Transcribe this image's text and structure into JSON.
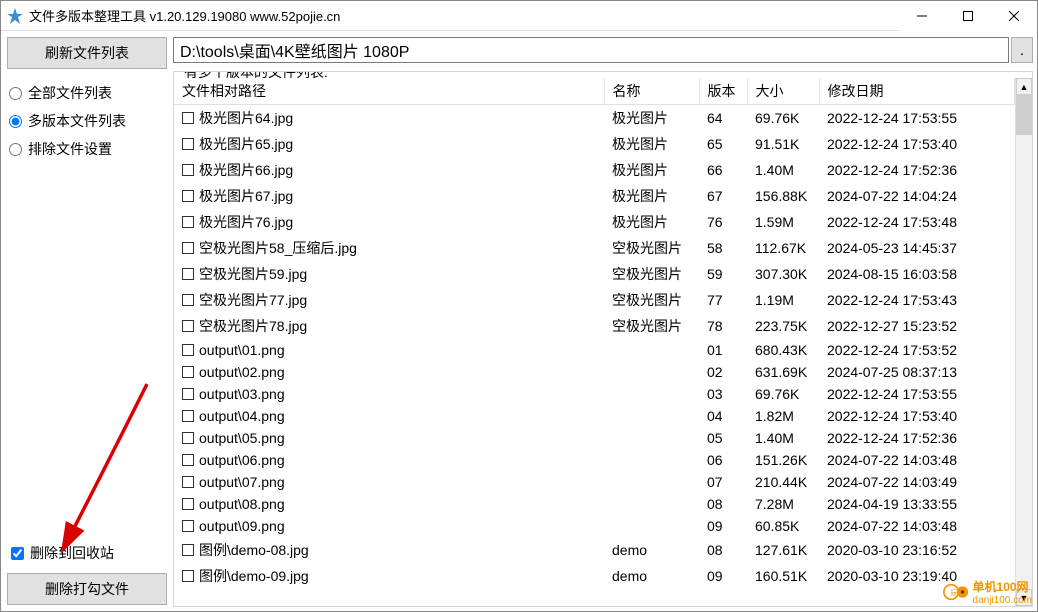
{
  "window": {
    "title": "文件多版本整理工具 v1.20.129.19080 www.52pojie.cn"
  },
  "sidebar": {
    "refresh_button": "刷新文件列表",
    "radios": {
      "all_files": "全部文件列表",
      "multi_version": "多版本文件列表",
      "exclude_settings": "排除文件设置"
    },
    "recycle_checkbox": "删除到回收站",
    "delete_checked_button": "删除打勾文件"
  },
  "main": {
    "path_value": "D:\\tools\\桌面\\4K壁纸图片 1080P",
    "path_browse": ".",
    "groupbox_label": "有多个版本的文件列表:",
    "columns": {
      "path": "文件相对路径",
      "name": "名称",
      "version": "版本",
      "size": "大小",
      "modified": "修改日期"
    },
    "rows": [
      {
        "path": "极光图片64.jpg",
        "name": "极光图片",
        "version": "64",
        "size": "69.76K",
        "modified": "2022-12-24 17:53:55"
      },
      {
        "path": "极光图片65.jpg",
        "name": "极光图片",
        "version": "65",
        "size": "91.51K",
        "modified": "2022-12-24 17:53:40"
      },
      {
        "path": "极光图片66.jpg",
        "name": "极光图片",
        "version": "66",
        "size": "1.40M",
        "modified": "2022-12-24 17:52:36"
      },
      {
        "path": "极光图片67.jpg",
        "name": "极光图片",
        "version": "67",
        "size": "156.88K",
        "modified": "2024-07-22 14:04:24"
      },
      {
        "path": "极光图片76.jpg",
        "name": "极光图片",
        "version": "76",
        "size": "1.59M",
        "modified": "2022-12-24 17:53:48"
      },
      {
        "path": "空极光图片58_压缩后.jpg",
        "name": "空极光图片",
        "version": "58",
        "size": "112.67K",
        "modified": "2024-05-23 14:45:37"
      },
      {
        "path": "空极光图片59.jpg",
        "name": "空极光图片",
        "version": "59",
        "size": "307.30K",
        "modified": "2024-08-15 16:03:58"
      },
      {
        "path": "空极光图片77.jpg",
        "name": "空极光图片",
        "version": "77",
        "size": "1.19M",
        "modified": "2022-12-24 17:53:43"
      },
      {
        "path": "空极光图片78.jpg",
        "name": "空极光图片",
        "version": "78",
        "size": "223.75K",
        "modified": "2022-12-27 15:23:52"
      },
      {
        "path": "output\\01.png",
        "name": "",
        "version": "01",
        "size": "680.43K",
        "modified": "2022-12-24 17:53:52"
      },
      {
        "path": "output\\02.png",
        "name": "",
        "version": "02",
        "size": "631.69K",
        "modified": "2024-07-25 08:37:13"
      },
      {
        "path": "output\\03.png",
        "name": "",
        "version": "03",
        "size": "69.76K",
        "modified": "2022-12-24 17:53:55"
      },
      {
        "path": "output\\04.png",
        "name": "",
        "version": "04",
        "size": "1.82M",
        "modified": "2022-12-24 17:53:40"
      },
      {
        "path": "output\\05.png",
        "name": "",
        "version": "05",
        "size": "1.40M",
        "modified": "2022-12-24 17:52:36"
      },
      {
        "path": "output\\06.png",
        "name": "",
        "version": "06",
        "size": "151.26K",
        "modified": "2024-07-22 14:03:48"
      },
      {
        "path": "output\\07.png",
        "name": "",
        "version": "07",
        "size": "210.44K",
        "modified": "2024-07-22 14:03:49"
      },
      {
        "path": "output\\08.png",
        "name": "",
        "version": "08",
        "size": "7.28M",
        "modified": "2024-04-19 13:33:55"
      },
      {
        "path": "output\\09.png",
        "name": "",
        "version": "09",
        "size": "60.85K",
        "modified": "2024-07-22 14:03:48"
      },
      {
        "path": "图例\\demo-08.jpg",
        "name": "demo",
        "version": "08",
        "size": "127.61K",
        "modified": "2020-03-10 23:16:52"
      },
      {
        "path": "图例\\demo-09.jpg",
        "name": "demo",
        "version": "09",
        "size": "160.51K",
        "modified": "2020-03-10 23:19:40"
      }
    ]
  },
  "watermark": {
    "text1": "单机100网",
    "text2": "danji100.com"
  }
}
